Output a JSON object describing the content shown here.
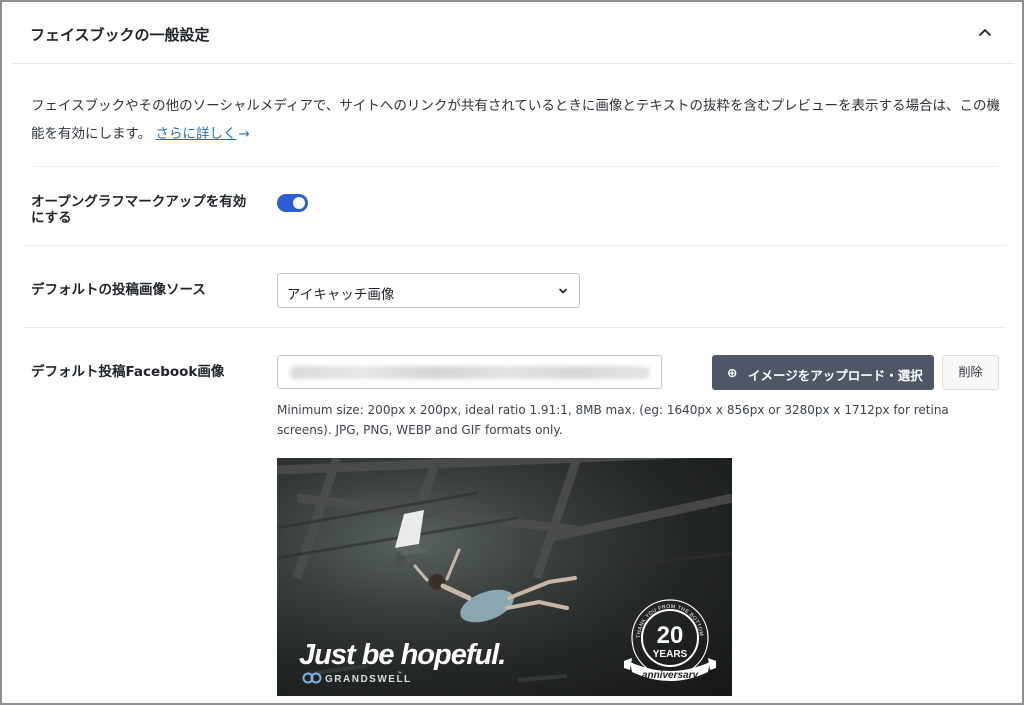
{
  "panel": {
    "title": "フェイスブックの一般設定",
    "description": "フェイスブックやその他のソーシャルメディアで、サイトへのリンクが共有されているときに画像とテキストの抜粋を含むプレビューを表示する場合は、この機能を有効にします。",
    "learn_more": "さらに詳しく",
    "learn_more_arrow": "→"
  },
  "og_markup": {
    "label_line1": "オープングラフマークアップを有効",
    "label_line2": "にする",
    "enabled": true
  },
  "image_source": {
    "label": "デフォルトの投稿画像ソース",
    "value": "アイキャッチ画像"
  },
  "default_image": {
    "label": "デフォルト投稿Facebook画像",
    "upload_icon": "⊕",
    "upload_label": "イメージをアップロード・選択",
    "delete_label": "削除",
    "help": "Minimum size: 200px x 200px, ideal ratio 1.91:1, 8MB max. (eg: 1640px x 856px or 3280px x 1712px for retina screens). JPG, PNG, WEBP and GIF formats only."
  },
  "preview_image": {
    "headline": "Just be hopeful.",
    "brand": "GRANDSWELL",
    "brand_tm": "™",
    "badge_ring_text": "THANK YOU FROM THE BOTTOM OF MY HEART",
    "badge_number": "20",
    "badge_years": "YEARS",
    "badge_ribbon": "anniversary"
  },
  "colors": {
    "accent": "#2271b1",
    "toggle_on": "#2c5fd5",
    "primary_button": "#4f5767"
  }
}
